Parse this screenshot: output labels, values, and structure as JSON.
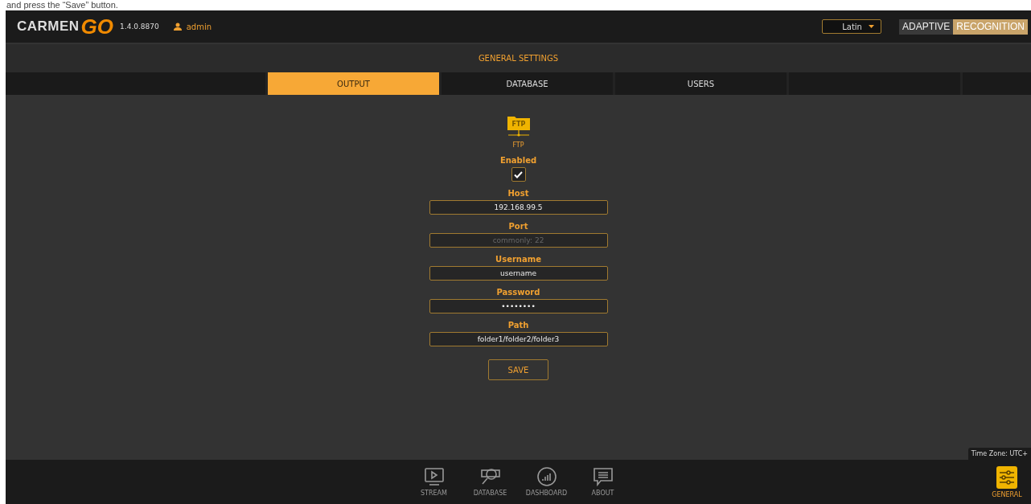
{
  "doc_caption": "and press the “Save” button.",
  "header": {
    "logo_text": "CARMEN",
    "logo_accent": "GO",
    "version": "1.4.0.8870",
    "user": "admin",
    "language": "Latin",
    "brand_left": "ADAPTIVE",
    "brand_right": "RECOGNITION"
  },
  "page_title": "GENERAL SETTINGS",
  "tabs": [
    {
      "label": "OUTPUT",
      "selected": true
    },
    {
      "label": "DATABASE",
      "selected": false
    },
    {
      "label": "USERS",
      "selected": false
    }
  ],
  "output": {
    "icon_label": "FTP",
    "icon_caption": "FTP",
    "enabled_label": "Enabled",
    "enabled": true,
    "fields": [
      {
        "label": "Host",
        "value": "192.168.99.5"
      },
      {
        "label": "Port",
        "placeholder": "commonly: 22"
      },
      {
        "label": "Username",
        "value": "username"
      },
      {
        "label": "Password",
        "value": "••••••••"
      },
      {
        "label": "Path",
        "value": "folder1/folder2/folder3"
      }
    ],
    "save": "SAVE"
  },
  "time_zone": "Time Zone: UTC+",
  "nav": [
    {
      "label": "STREAM",
      "selected": false
    },
    {
      "label": "DATABASE",
      "selected": false
    },
    {
      "label": "DASHBOARD",
      "selected": false
    },
    {
      "label": "ABOUT",
      "selected": false
    }
  ],
  "nav_right": {
    "label": "GENERAL",
    "selected": true
  }
}
